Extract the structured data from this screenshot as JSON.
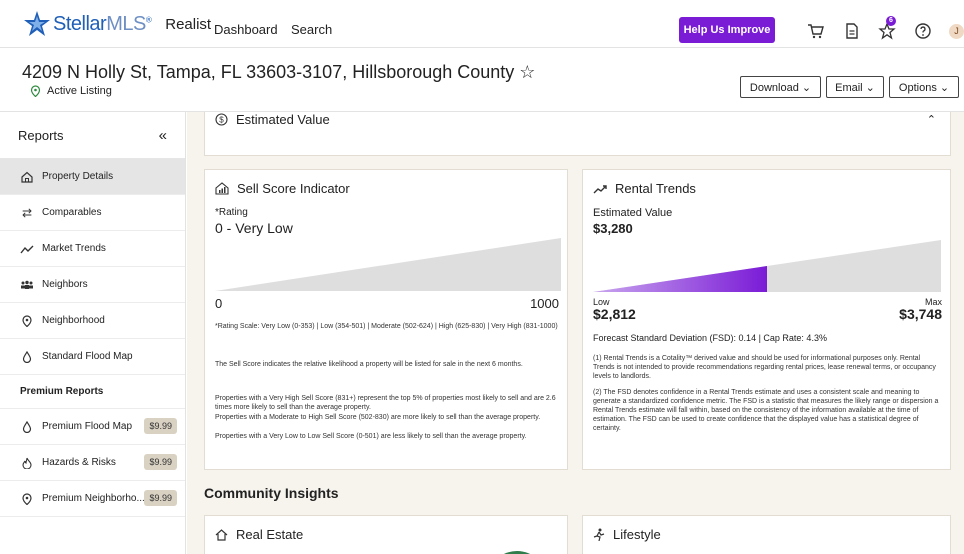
{
  "nav": {
    "logo_stellar": "Stellar",
    "logo_mls": "MLS",
    "logo_reg": "®",
    "realist": "Realist",
    "links": [
      "Dashboard",
      "Search"
    ],
    "help_label": "Help Us Improve",
    "badge_count": "6",
    "avatar_initial": "J"
  },
  "property": {
    "address": "4209 N Holly St, Tampa, FL 33603-3107, Hillsborough County ☆",
    "status": "Active Listing"
  },
  "actions": {
    "download": "Download ⌄",
    "email": "Email ⌄",
    "options": "Options ⌄"
  },
  "sidebar": {
    "title": "Reports",
    "collapse": "«",
    "items": [
      {
        "label": "Property Details",
        "icon": "home-icon"
      },
      {
        "label": "Comparables",
        "icon": "swap-icon"
      },
      {
        "label": "Market Trends",
        "icon": "trend-icon"
      },
      {
        "label": "Neighbors",
        "icon": "people-icon"
      },
      {
        "label": "Neighborhood",
        "icon": "location-icon"
      },
      {
        "label": "Standard Flood Map",
        "icon": "drop-icon"
      }
    ],
    "premium_title": "Premium Reports",
    "premium_items": [
      {
        "label": "Premium Flood Map",
        "price": "$9.99",
        "icon": "drop-icon"
      },
      {
        "label": "Hazards & Risks",
        "price": "$9.99",
        "icon": "fire-icon"
      },
      {
        "label": "Premium Neighborho...",
        "price": "$9.99",
        "icon": "location-icon"
      }
    ]
  },
  "estimated_value": {
    "title": "Estimated Value"
  },
  "sell_score": {
    "title": "Sell Score Indicator",
    "rating_label": "*Rating",
    "rating_value": "0 - Very Low",
    "min": "0",
    "max": "1000",
    "score_fraction": 0.0,
    "scale_note": "*Rating Scale: Very Low (0-353) | Low (354-501) | Moderate (502-624) | High (625-830) | Very High (831-1000)",
    "desc1": "The Sell Score indicates the relative likelihood a property will be listed for sale in the next 6 months.",
    "desc2": "Properties with a Very High Sell Score (831+) represent the top 5% of properties most likely to sell and are 2.6 times more likely to sell than the average property.",
    "desc3": "Properties with a Moderate to High Sell Score (502-830) are more likely to sell than the average property.",
    "desc4": "Properties with a Very Low to Low Sell Score (0-501) are less likely to sell than the average property."
  },
  "rental": {
    "title": "Rental Trends",
    "est_label": "Estimated Value",
    "est_value": "$3,280",
    "low_label": "Low",
    "low_value": "$2,812",
    "max_label": "Max",
    "max_value": "$3,748",
    "estimate_fraction": 0.5,
    "fsd": "Forecast Standard Deviation (FSD): 0.14  |  Cap Rate: 4.3%",
    "note1": "(1) Rental Trends is a Cotality™ derived value and should be used for informational purposes only. Rental Trends is not intended to provide recommendations regarding rental prices, lease renewal terms, or occupancy levels to landlords.",
    "note2": "(2) The FSD denotes confidence in a Rental Trends estimate and uses a consistent scale and meaning to generate a standardized confidence metric. The FSD is a statistic that measures the likely range or dispersion a Rental Trends estimate will fall within, based on the consistency of the information available at the time of estimation. The FSD can be used to create confidence that the displayed value has a statistical degree of certainty."
  },
  "community": {
    "title": "Community Insights",
    "real_estate": "Real Estate",
    "lifestyle": "Lifestyle"
  }
}
